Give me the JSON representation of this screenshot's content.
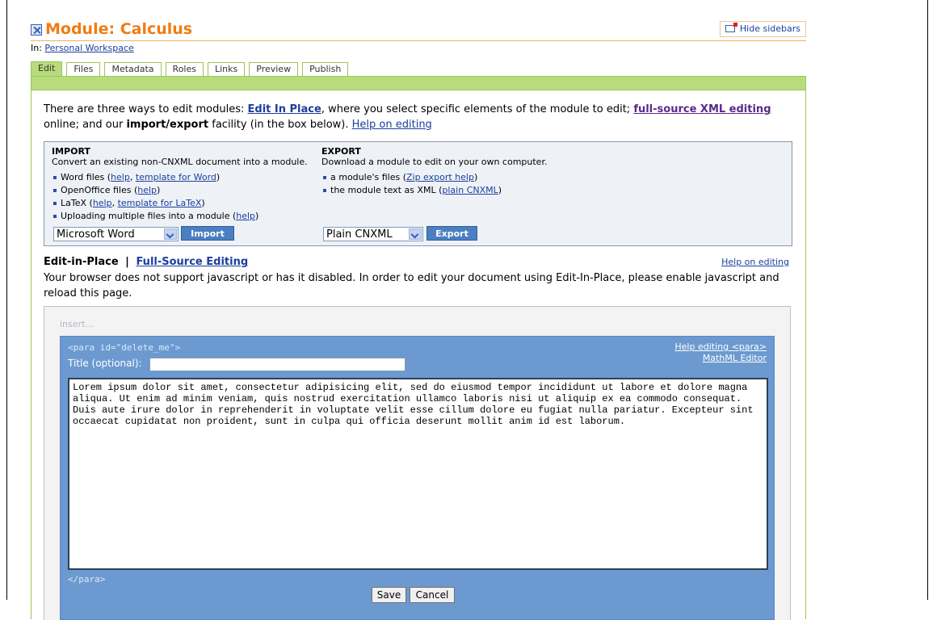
{
  "header": {
    "title": "Module: Calculus",
    "hide_sidebars": "Hide sidebars",
    "breadcrumb_prefix": "In:",
    "breadcrumb_link": "Personal Workspace"
  },
  "tabs": [
    "Edit",
    "Files",
    "Metadata",
    "Roles",
    "Links",
    "Preview",
    "Publish"
  ],
  "intro": {
    "t1": "There are three ways to edit modules: ",
    "link1": "Edit In Place",
    "t2": ", where you select specific elements of the module to edit; ",
    "link2": "full-source XML editing",
    "t3": " online; and our ",
    "bold": "import/export",
    "t4": " facility (in the box below). ",
    "link3": "Help on editing"
  },
  "import": {
    "heading": "IMPORT",
    "desc": "Convert an existing non-CNXML document into a module.",
    "items": {
      "word": "Word files (",
      "word_help": "help",
      "comma": ", ",
      "word_template": "template for Word",
      "close": ")",
      "oo": "OpenOffice files (",
      "oo_help": "help",
      "latex": "LaTeX (",
      "latex_help": "help",
      "latex_template": "template for LaTeX",
      "multi": "Uploading multiple files into a module (",
      "multi_help": "help"
    },
    "select_value": "Microsoft Word",
    "button": "Import"
  },
  "export": {
    "heading": "EXPORT",
    "desc": "Download a module to edit on your own computer.",
    "items": {
      "files": "a module's files (",
      "files_help": "Zip export help",
      "xml": "the module text as XML (",
      "xml_link": "plain CNXML"
    },
    "select_value": "Plain CNXML",
    "button": "Export"
  },
  "eip": {
    "current": "Edit-in-Place",
    "separator": "|",
    "other": "Full-Source Editing",
    "help": "Help on editing",
    "message": "Your browser does not support javascript or has it disabled. In order to edit your document using Edit-In-Place, please enable javascript and reload this page."
  },
  "editor": {
    "insert": "insert...",
    "open_tag": "<para id=\"delete_me\">",
    "help_para": "Help editing <para>",
    "mathml": "MathML Editor",
    "title_label": "Title (optional):",
    "title_value": "",
    "body": "Lorem ipsum dolor sit amet, consectetur adipisicing elit, sed do eiusmod tempor incididunt ut labore et dolore magna aliqua. Ut enim ad minim veniam, quis nostrud exercitation ullamco laboris nisi ut aliquip ex ea commodo consequat. Duis aute irure dolor in reprehenderit in voluptate velit esse cillum dolore eu fugiat nulla pariatur. Excepteur sint occaecat cupidatat non proident, sunt in culpa qui officia deserunt mollit anim id est laborum.",
    "close_tag": "</para>",
    "save": "Save",
    "cancel": "Cancel"
  }
}
